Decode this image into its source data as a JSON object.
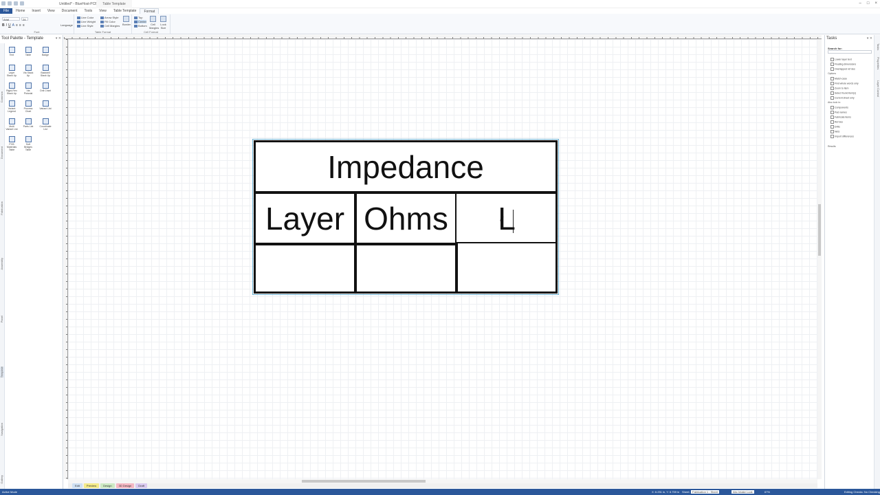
{
  "app": {
    "title": "Untitled* - BlueHost-PCB 6.7",
    "context_tab": "Table Template",
    "window_controls": [
      "–",
      "□",
      "×"
    ]
  },
  "ribbon_tabs": [
    "File",
    "Home",
    "Insert",
    "View",
    "Document",
    "Tools",
    "View",
    "Table Template",
    "Format"
  ],
  "ribbon": {
    "font_name": "Arial",
    "font_size": "24",
    "line_color": "Line Color",
    "line_weight": "Line Weight",
    "line_style": "Line Style",
    "arrow_style": "Arrow Style",
    "fill_color": "Fill Color",
    "cell_margins_label": "Cell Margins",
    "language": "Language",
    "border": "Border",
    "top": "Top",
    "center": "Center",
    "bottom": "Bottom",
    "cell_margins": "Cell Margins",
    "lock_size": "Lock Size",
    "group_font": "Font",
    "group_table_format": "Table Format",
    "group_cell_format": "Cell Format"
  },
  "palette": {
    "title": "Tool Palette - Template",
    "vtabs": [
      "Common",
      "Document",
      "Fabrication",
      "Assembly",
      "Panel",
      "Template",
      "Navigation",
      "Gallery"
    ],
    "tools": [
      {
        "label": "Text",
        "icon": "text-icon"
      },
      {
        "label": "Table",
        "icon": "table-icon"
      },
      {
        "label": "Badge",
        "icon": "badge-icon"
      },
      {
        "label": "Layer Stack Up",
        "icon": "layer-stack-icon"
      },
      {
        "label": "Via Stack Up",
        "icon": "via-stack-icon"
      },
      {
        "label": "Backdrill Stack Up",
        "icon": "backdrill-icon"
      },
      {
        "label": "Rigid-Flex Stack Up",
        "icon": "rigid-flex-icon"
      },
      {
        "label": "Via Pictorial",
        "icon": "via-pictorial-icon"
      },
      {
        "label": "Drill Chart",
        "icon": "drill-chart-icon"
      },
      {
        "label": "Variant Legend",
        "icon": "variant-legend-icon"
      },
      {
        "label": "Process Chart",
        "icon": "process-chart-icon"
      },
      {
        "label": "Variant List",
        "icon": "variant-list-icon"
      },
      {
        "label": "Multi Variant List",
        "icon": "multi-variant-icon"
      },
      {
        "label": "Parts List",
        "icon": "parts-list-icon"
      },
      {
        "label": "Coordinate List",
        "icon": "coordinate-icon"
      },
      {
        "label": "PCB Materials Table",
        "icon": "materials-icon"
      },
      {
        "label": "Soft Bridges Table",
        "icon": "bridges-icon"
      }
    ]
  },
  "table": {
    "title": "Impedance",
    "headers": [
      "Layer",
      "Ohms",
      "L"
    ]
  },
  "sheet_tabs": [
    {
      "label": "Edit",
      "color": "#cfe0f3"
    },
    {
      "label": "Preview",
      "color": "#f3ea8a"
    },
    {
      "label": "Design",
      "color": "#cde9c4"
    },
    {
      "label": "3D Design",
      "color": "#f4b7c3"
    },
    {
      "label": "Draft",
      "color": "#d9c9ef"
    }
  ],
  "tasks": {
    "title": "Tasks",
    "search_label": "Search for:",
    "checks1": [
      "Lower layer text",
      "Floating dimensions",
      "Overlapped ref des"
    ],
    "options_label": "Options",
    "checks2": [
      "Match case",
      "Find whole words only",
      "Zoom to item",
      "Select found item(s)",
      "Current sheet only"
    ],
    "look_in_label": "Also look in:",
    "checks3": [
      "Components",
      "Pad names",
      "Fabricate items",
      "Ref des",
      "Drills",
      "Nets",
      "Import differences"
    ],
    "results_label": "Results",
    "rtabs": [
      "Tasks",
      "Properties",
      "Layer Control"
    ]
  },
  "status": {
    "mode": "Active Mode",
    "coords": "X: 6.251 in, Y: 6.759 in",
    "sheet_label": "Sheet:",
    "sheet_value": "Fabrication 1 : Sheet",
    "units": "Abc Intake Look",
    "zoom": "67%",
    "checks": "Editing Checks: No Checking"
  }
}
